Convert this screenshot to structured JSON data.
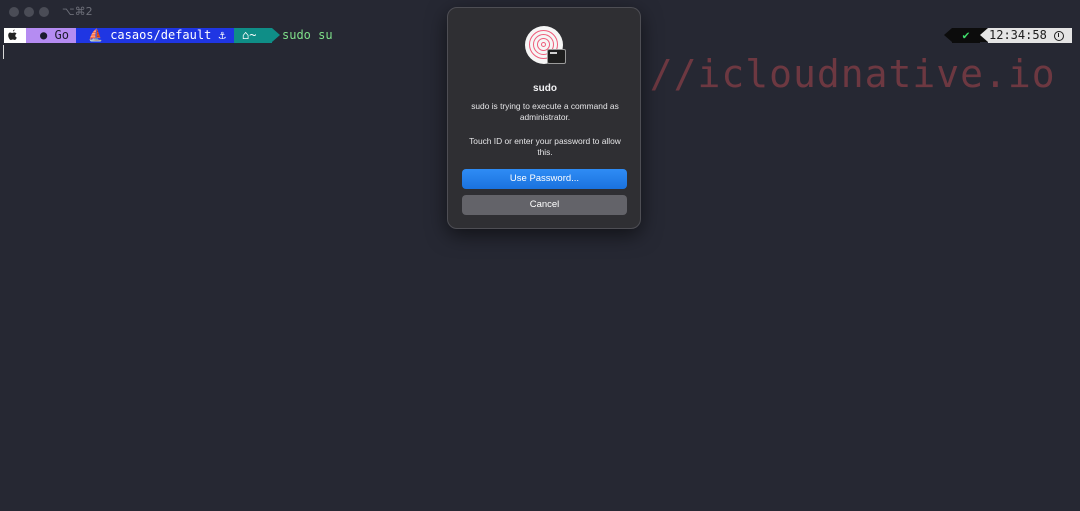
{
  "window": {
    "title": "⌥⌘2"
  },
  "prompt": {
    "segments": [
      {
        "name": "apple",
        "label": ""
      },
      {
        "name": "go",
        "label": "Go"
      },
      {
        "name": "kubernetes",
        "label": "casaos/default"
      },
      {
        "name": "home",
        "label": "~"
      }
    ],
    "command": "sudo su"
  },
  "status": {
    "time": "12:34:58"
  },
  "watermark": "s://icloudnative.io",
  "dialog": {
    "title": "sudo",
    "message": "sudo is trying to execute a command as administrator.",
    "hint": "Touch ID or enter your password to allow this.",
    "primary_button": "Use Password...",
    "secondary_button": "Cancel"
  },
  "colors": {
    "background": "#262833",
    "accent": "#1a72de",
    "go_segment": "#b58cf2",
    "k8s_segment": "#1f36e3",
    "home_segment": "#0f8e87",
    "command_text": "#7fe08a",
    "touchid": "#ef5d7b"
  }
}
